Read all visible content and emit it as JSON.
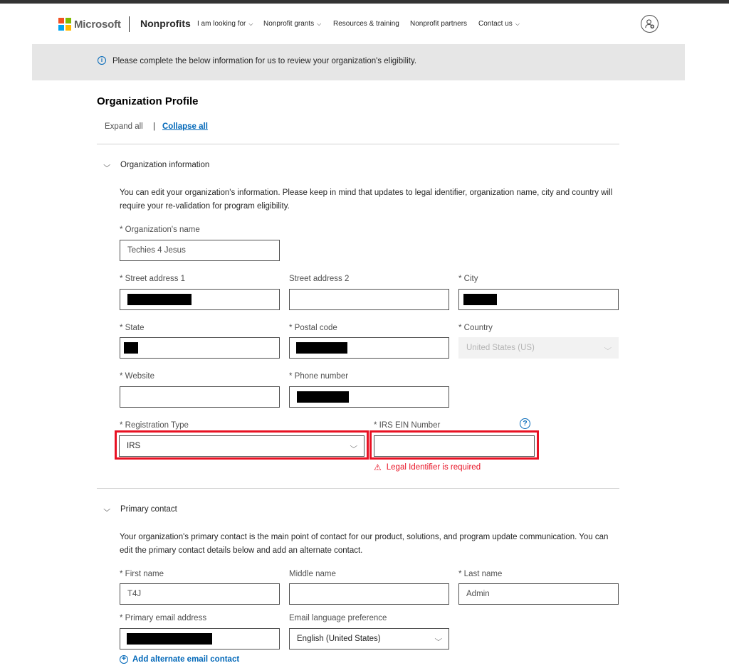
{
  "header": {
    "ms_logo_text": "Microsoft",
    "brand": "Nonprofits",
    "nav": [
      {
        "label": "I am looking for",
        "has_dropdown": true
      },
      {
        "label": "Nonprofit grants",
        "has_dropdown": true
      },
      {
        "label": "Resources & training",
        "has_dropdown": false
      },
      {
        "label": "Nonprofit partners",
        "has_dropdown": false
      },
      {
        "label": "Contact us",
        "has_dropdown": true
      }
    ],
    "avatar_icon": "user-plus-icon",
    "chevron": "⌵"
  },
  "banner": {
    "icon": "i",
    "text": "Please complete the below information for us to review your organization's eligibility."
  },
  "page": {
    "title": "Organization Profile",
    "expand_all": "Expand all",
    "separator": "|",
    "collapse_all": "Collapse all"
  },
  "org_section": {
    "heading": "Organization information",
    "description": "You can edit your organization's information. Please keep in mind that updates to legal identifier, organization name, city and country will require your re-validation for program eligibility.",
    "org_name_label": "* Organization's name",
    "org_name_value": "Techies 4 Jesus",
    "street1_label": "* Street address 1",
    "street2_label": "Street address 2",
    "city_label": "* City",
    "state_label": "* State",
    "postal_label": "* Postal code",
    "country_label": "* Country",
    "country_value": "United States (US)",
    "website_label": "* Website",
    "phone_label": "* Phone number",
    "reg_type_label": "* Registration Type",
    "reg_type_value": "IRS",
    "ein_label": "* IRS EIN Number",
    "ein_help": "?",
    "ein_error": "Legal Identifier is required",
    "error_icon": "⚠"
  },
  "contact_section": {
    "heading": "Primary contact",
    "description": "Your organization's primary contact is the main point of contact for our product, solutions, and program update communication. You can edit the primary contact details below and add an alternate contact.",
    "first_name_label": "* First name",
    "first_name_value": "T4J",
    "middle_name_label": "Middle name",
    "last_name_label": "* Last name",
    "last_name_value": "Admin",
    "email_label": "* Primary email address",
    "language_label": "Email language preference",
    "language_value": "English (United States)",
    "add_alternate": "Add alternate email contact",
    "add_icon": "+"
  },
  "colors": {
    "accent": "#0067b8",
    "error": "#e81123",
    "banner_bg": "#e6e6e6",
    "ms_red": "#f25022",
    "ms_green": "#7fba00",
    "ms_blue": "#00a4ef",
    "ms_yellow": "#ffb900"
  }
}
